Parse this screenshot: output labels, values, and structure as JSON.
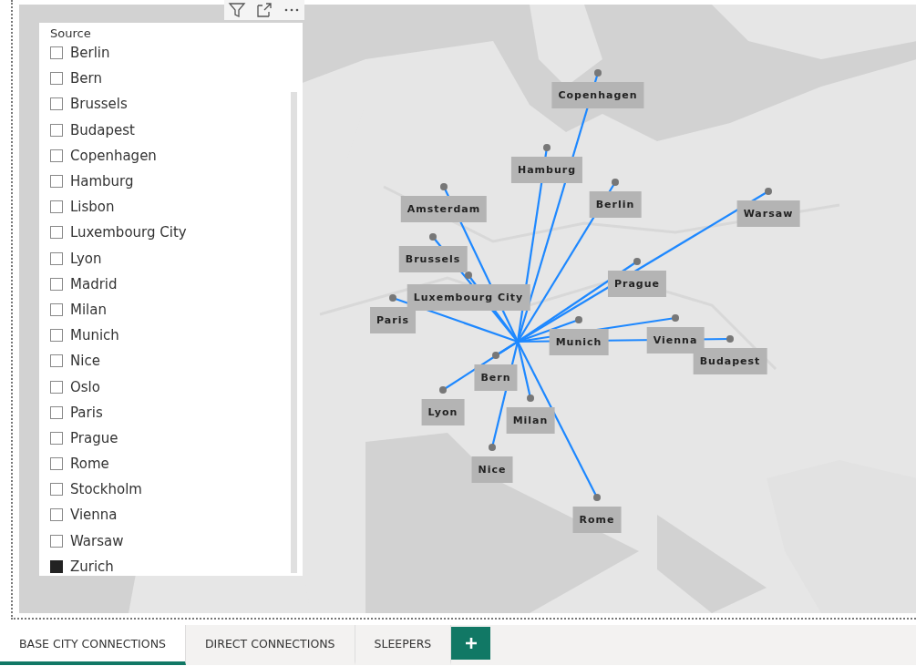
{
  "slicer": {
    "title": "Source",
    "items": [
      {
        "label": "Berlin",
        "checked": false
      },
      {
        "label": "Bern",
        "checked": false
      },
      {
        "label": "Brussels",
        "checked": false
      },
      {
        "label": "Budapest",
        "checked": false
      },
      {
        "label": "Copenhagen",
        "checked": false
      },
      {
        "label": "Hamburg",
        "checked": false
      },
      {
        "label": "Lisbon",
        "checked": false
      },
      {
        "label": "Luxembourg City",
        "checked": false
      },
      {
        "label": "Lyon",
        "checked": false
      },
      {
        "label": "Madrid",
        "checked": false
      },
      {
        "label": "Milan",
        "checked": false
      },
      {
        "label": "Munich",
        "checked": false
      },
      {
        "label": "Nice",
        "checked": false
      },
      {
        "label": "Oslo",
        "checked": false
      },
      {
        "label": "Paris",
        "checked": false
      },
      {
        "label": "Prague",
        "checked": false
      },
      {
        "label": "Rome",
        "checked": false
      },
      {
        "label": "Stockholm",
        "checked": false
      },
      {
        "label": "Vienna",
        "checked": false
      },
      {
        "label": "Warsaw",
        "checked": false
      },
      {
        "label": "Zurich",
        "checked": true
      }
    ]
  },
  "map": {
    "connections": [
      {
        "city": "Copenhagen"
      },
      {
        "city": "Hamburg"
      },
      {
        "city": "Berlin"
      },
      {
        "city": "Amsterdam"
      },
      {
        "city": "Warsaw"
      },
      {
        "city": "Brussels"
      },
      {
        "city": "Prague"
      },
      {
        "city": "Luxembourg City"
      },
      {
        "city": "Paris"
      },
      {
        "city": "Vienna"
      },
      {
        "city": "Munich"
      },
      {
        "city": "Budapest"
      },
      {
        "city": "Bern"
      },
      {
        "city": "Lyon"
      },
      {
        "city": "Milan"
      },
      {
        "city": "Nice"
      },
      {
        "city": "Rome"
      }
    ]
  },
  "tabs": [
    {
      "label": "BASE CITY CONNECTIONS",
      "selected": true
    },
    {
      "label": "DIRECT CONNECTIONS",
      "selected": false
    },
    {
      "label": "SLEEPERS",
      "selected": false
    }
  ]
}
